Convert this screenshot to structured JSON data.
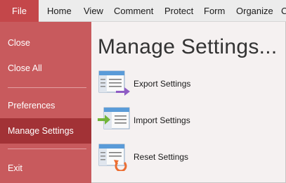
{
  "menubar": {
    "file": "File",
    "items": [
      "Home",
      "View",
      "Comment",
      "Protect",
      "Form",
      "Organize",
      "C"
    ]
  },
  "sidebar": {
    "items": [
      "Close",
      "Close All",
      "Preferences",
      "Manage Settings",
      "Exit"
    ],
    "selected": "Manage Settings"
  },
  "main": {
    "title": "Manage Settings...",
    "actions": [
      {
        "label": "Export Settings",
        "icon": "export-settings-icon"
      },
      {
        "label": "Import Settings",
        "icon": "import-settings-icon"
      },
      {
        "label": "Reset Settings",
        "icon": "reset-settings-icon"
      }
    ]
  },
  "colors": {
    "accent": "#c4474a",
    "sidebar": "#c85a5d",
    "sidebar_selected": "#a23236",
    "export_arrow": "#8e5cc4",
    "import_arrow": "#72b43a",
    "reset_arrow": "#ec6e32"
  }
}
